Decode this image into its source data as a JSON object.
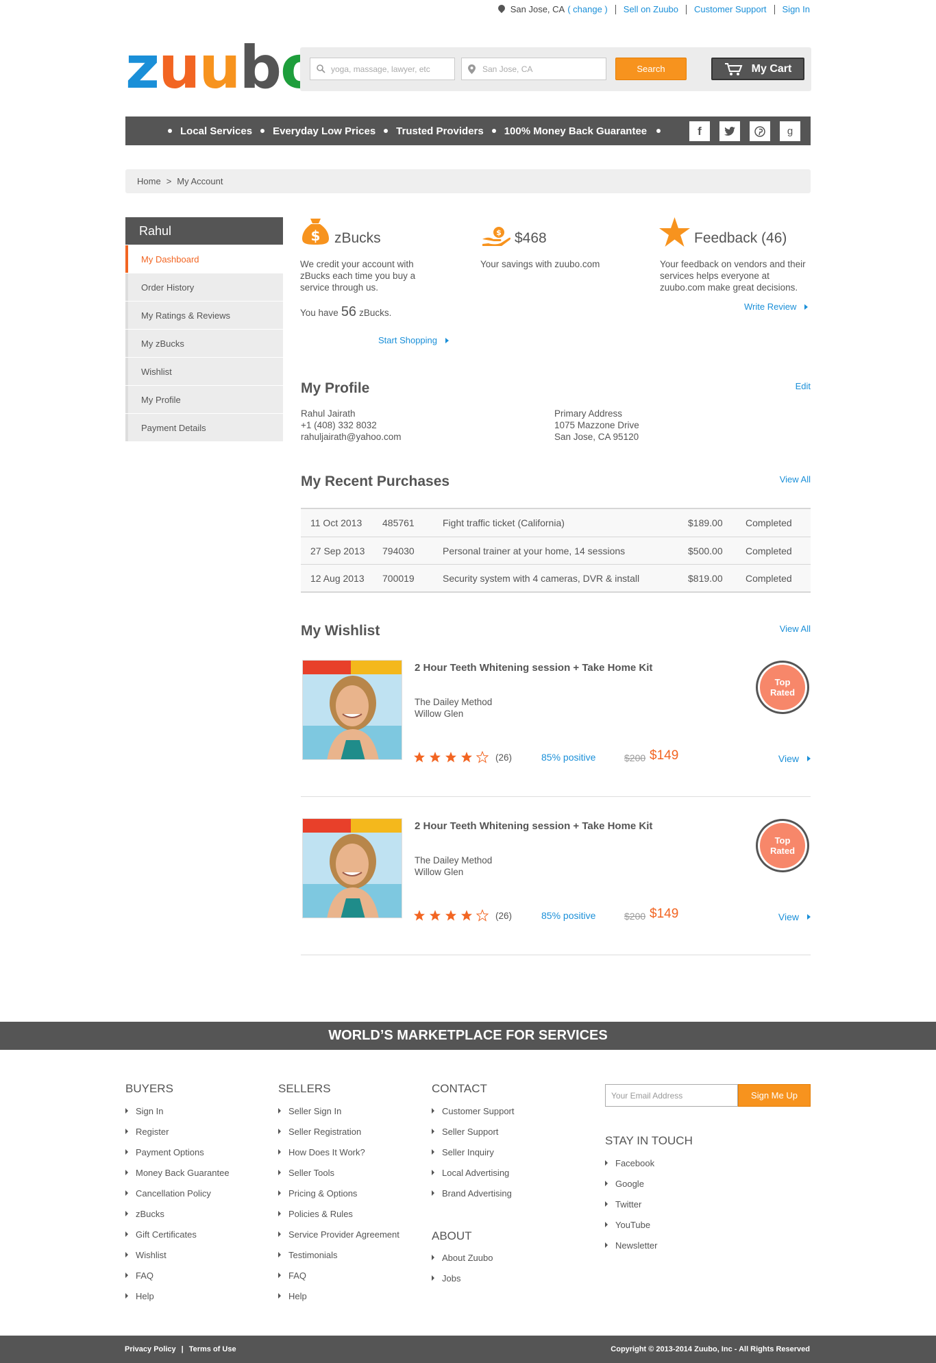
{
  "topbar": {
    "location": "San Jose, CA",
    "change": "( change )",
    "sell": "Sell on Zuubo",
    "support": "Customer Support",
    "signin": "Sign In"
  },
  "logo": {
    "letters": [
      "z",
      "u",
      "u",
      "b",
      "o"
    ],
    "colors": [
      "#1a8fd8",
      "#f26522",
      "#f7931e",
      "#555555",
      "#1e9e3c"
    ]
  },
  "search": {
    "query_placeholder": "yoga, massage, lawyer, etc",
    "location_placeholder": "San Jose, CA",
    "button": "Search",
    "cart": "My Cart"
  },
  "nav": {
    "items": [
      "Local Services",
      "Everyday Low Prices",
      "Trusted Providers",
      "100% Money Back Guarantee"
    ],
    "social": [
      "facebook-icon",
      "twitter-icon",
      "pinterest-icon",
      "google-icon"
    ]
  },
  "breadcrumb": {
    "home": "Home",
    "sep": ">",
    "current": "My Account"
  },
  "sidebar": {
    "user": "Rahul",
    "items": [
      "My Dashboard",
      "Order History",
      "My Ratings & Reviews",
      "My zBucks",
      "Wishlist",
      "My Profile",
      "Payment Details"
    ],
    "active_index": 0
  },
  "stats": {
    "zbucks": {
      "title": "zBucks",
      "desc": "We credit your account with zBucks each time you buy a service through us.",
      "have_prefix": "You have",
      "count": "56",
      "have_suffix": "zBucks.",
      "link": "Start Shopping"
    },
    "savings": {
      "title": "$468",
      "desc": "Your savings with zuubo.com"
    },
    "feedback": {
      "title": "Feedback (46)",
      "desc": "Your feedback on vendors and their services helps everyone at zuubo.com make great decisions.",
      "link": "Write Review"
    }
  },
  "profile": {
    "title": "My Profile",
    "edit": "Edit",
    "name": "Rahul Jairath",
    "phone": "+1 (408) 332 8032",
    "email": "rahuljairath@yahoo.com",
    "address_label": "Primary Address",
    "address_line1": "1075 Mazzone Drive",
    "address_line2": "San Jose, CA 95120"
  },
  "purchases": {
    "title": "My Recent Purchases",
    "view_all": "View All",
    "rows": [
      {
        "date": "11 Oct 2013",
        "id": "485761",
        "desc": "Fight traffic ticket (California)",
        "amount": "$189.00",
        "status": "Completed"
      },
      {
        "date": "27 Sep 2013",
        "id": "794030",
        "desc": "Personal trainer at your home, 14 sessions",
        "amount": "$500.00",
        "status": "Completed"
      },
      {
        "date": "12 Aug 2013",
        "id": "700019",
        "desc": "Security system with 4 cameras, DVR & install",
        "amount": "$819.00",
        "status": "Completed"
      }
    ]
  },
  "wishlist": {
    "title": "My Wishlist",
    "view_all": "View All",
    "items": [
      {
        "title": "2 Hour Teeth Whitening  session + Take Home Kit",
        "vendor": "The Dailey Method",
        "area": "Willow Glen",
        "rating": 4,
        "reviews": "(26)",
        "positive": "85% positive",
        "old_price": "$200",
        "price": "$149",
        "view": "View",
        "badge": [
          "Top",
          "Rated"
        ]
      },
      {
        "title": "2 Hour Teeth Whitening  session + Take Home Kit",
        "vendor": "The Dailey Method",
        "area": "Willow Glen",
        "rating": 4,
        "reviews": "(26)",
        "positive": "85% positive",
        "old_price": "$200",
        "price": "$149",
        "view": "View",
        "badge": [
          "Top",
          "Rated"
        ]
      }
    ]
  },
  "footer": {
    "tagline": "WORLD’S MARKETPLACE FOR SERVICES",
    "buyers": {
      "title": "BUYERS",
      "items": [
        "Sign In",
        "Register",
        "Payment Options",
        "Money Back Guarantee",
        "Cancellation Policy",
        "zBucks",
        "Gift Certificates",
        "Wishlist",
        "FAQ",
        "Help"
      ]
    },
    "sellers": {
      "title": "SELLERS",
      "items": [
        "Seller Sign In",
        "Seller Registration",
        "How Does It Work?",
        "Seller Tools",
        "Pricing & Options",
        "Policies & Rules",
        "Service Provider Agreement",
        "Testimonials",
        "FAQ",
        "Help"
      ]
    },
    "contact": {
      "title": "CONTACT",
      "items": [
        "Customer Support",
        "Seller Support",
        "Seller Inquiry",
        "Local Advertising",
        "Brand Advertising"
      ]
    },
    "about": {
      "title": "ABOUT",
      "items": [
        "About Zuubo",
        "Jobs"
      ]
    },
    "newsletter": {
      "placeholder": "Your Email Address",
      "button": "Sign Me Up"
    },
    "stay": {
      "title": "STAY IN TOUCH",
      "items": [
        "Facebook",
        "Google",
        "Twitter",
        "YouTube",
        "Newsletter"
      ]
    },
    "privacy": "Privacy Policy",
    "sep": "|",
    "terms": "Terms of Use",
    "copyright": "Copyright © 2013-2014 Zuubo, Inc - All Rights Reserved"
  }
}
